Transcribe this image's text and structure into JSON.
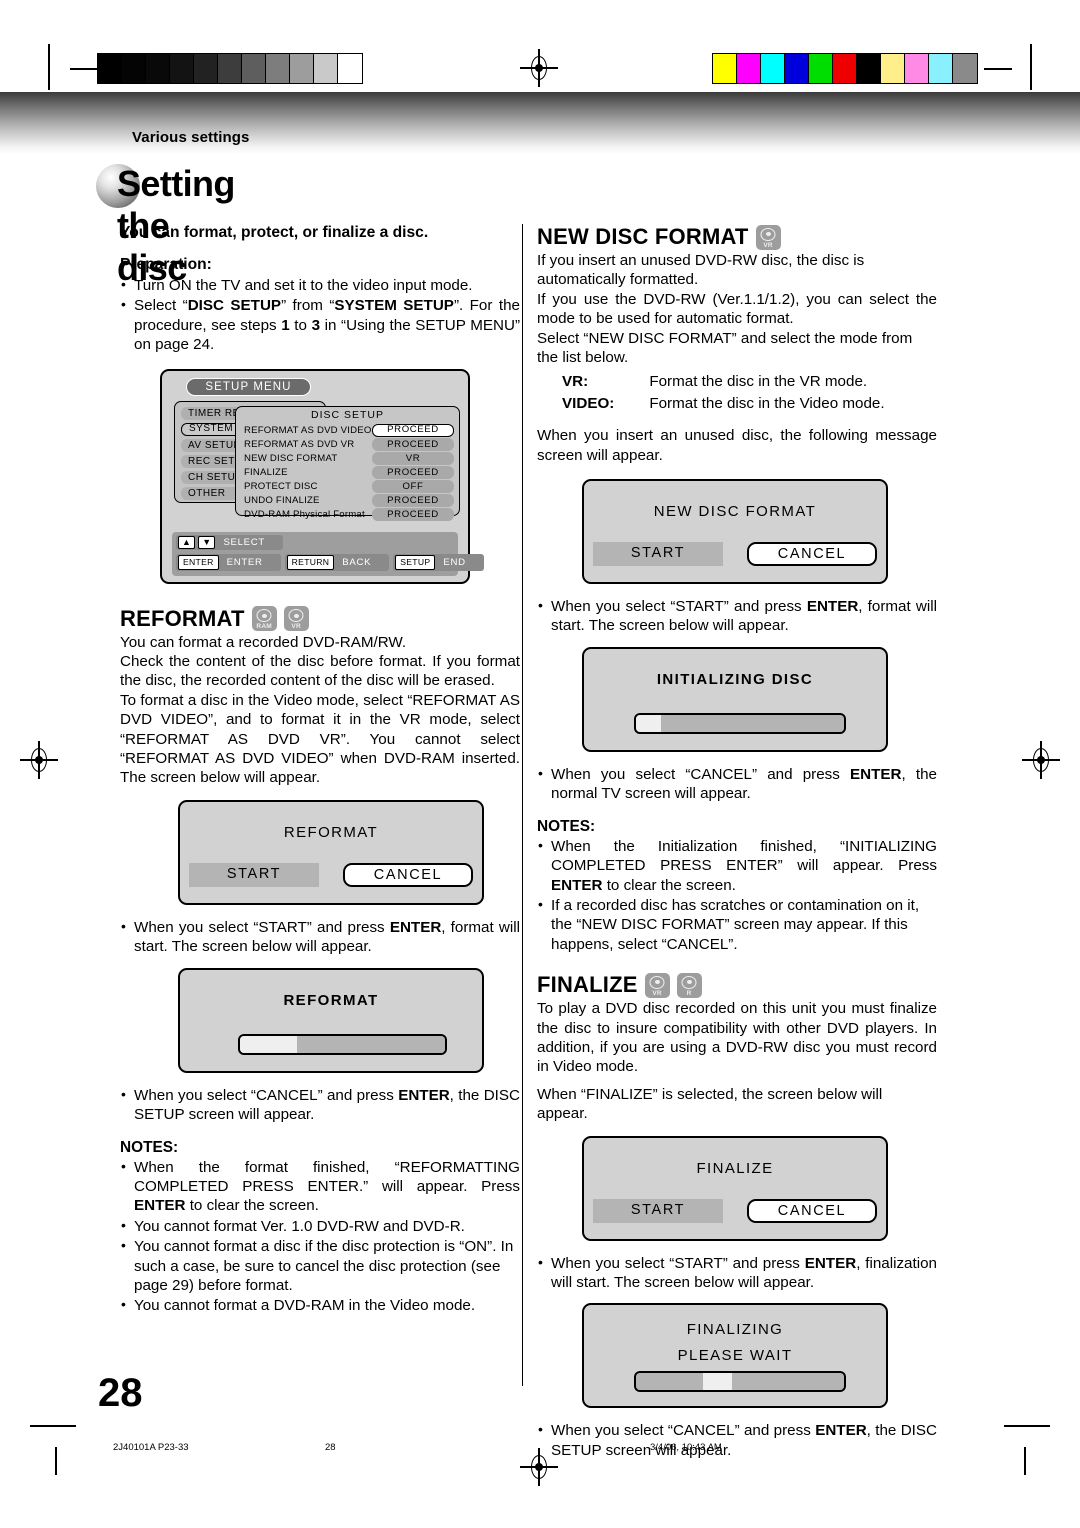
{
  "header": {
    "running_head": "Various settings",
    "page_title": "Setting the disc"
  },
  "intro": {
    "lead": "You can format, protect, or finalize a disc.",
    "prep_heading": "Preparation:",
    "bullets": [
      "Turn ON the TV and set it to the video input mode.",
      "Select “DISC SETUP” from “SYSTEM SETUP”. For the procedure, see steps 1 to 3 in “Using the SETUP MENU” on page 24."
    ]
  },
  "setup_menu_figure": {
    "title": "SETUP MENU",
    "left_items": [
      "TIMER REC SETUP",
      "SYSTEM SETUP",
      "AV SETUP",
      "REC SETUP",
      "CH SETUP",
      "OTHER"
    ],
    "selected_left_item": "SYSTEM SETUP",
    "submenu_title": "DISC SETUP",
    "rows": [
      {
        "label": "REFORMAT AS DVD VIDEO",
        "value": "PROCEED",
        "selected": true
      },
      {
        "label": "REFORMAT AS DVD VR",
        "value": "PROCEED",
        "selected": false
      },
      {
        "label": "NEW DISC FORMAT",
        "value": "VR",
        "selected": false
      },
      {
        "label": "FINALIZE",
        "value": "PROCEED",
        "selected": false
      },
      {
        "label": "PROTECT DISC",
        "value": "OFF",
        "selected": false
      },
      {
        "label": "UNDO FINALIZE",
        "value": "PROCEED",
        "selected": false
      },
      {
        "label": "DVD-RAM Physical Format",
        "value": "PROCEED",
        "selected": false
      }
    ],
    "footer_keys": [
      {
        "key": "▲ ▼",
        "action": "SELECT"
      },
      {
        "key": "ENTER",
        "action": "ENTER"
      },
      {
        "key": "RETURN",
        "action": "BACK"
      },
      {
        "key": "SETUP",
        "action": "END"
      }
    ]
  },
  "reformat": {
    "heading": "REFORMAT",
    "badges": [
      "RAM",
      "VR"
    ],
    "paragraphs": [
      "You can format a recorded DVD-RAM/RW.",
      "Check the content of the disc before format. If you format the disc, the recorded content of the disc will be erased.",
      "To format a disc in the Video mode, select “REFORMAT AS DVD VIDEO”, and to format it in the VR mode, select “REFORMAT AS DVD VR”. You cannot select “REFORMAT AS DVD VIDEO” when DVD-RAM inserted. The screen below will appear."
    ],
    "dialog": {
      "title": "REFORMAT",
      "start_label": "START",
      "cancel_label": "CANCEL"
    },
    "bullet_start": "When you select “START” and press ENTER, format will start. The screen below will appear.",
    "progress": {
      "title": "REFORMAT",
      "percent": 28
    },
    "bullet_cancel": "When you select “CANCEL” and press ENTER, the DISC SETUP screen will appear.",
    "notes_heading": "NOTES:",
    "notes": [
      "When the format finished, “REFORMATTING COMPLETED PRESS ENTER.” will appear. Press ENTER to clear the screen.",
      "You cannot format Ver. 1.0 DVD-RW and DVD-R.",
      "You cannot format a disc if the disc protection is “ON”. In such a case, be sure to cancel the disc protection (see page 29) before format.",
      "You cannot format a DVD-RAM in the Video mode."
    ]
  },
  "new_disc_format": {
    "heading": "NEW DISC FORMAT",
    "badges": [
      "VR"
    ],
    "paragraphs": [
      "If you insert an unused DVD-RW disc, the disc is automatically formatted.",
      "If you use the DVD-RW (Ver.1.1/1.2), you can select the mode to be used for automatic format.",
      "Select “NEW DISC FORMAT” and select the mode from the list below."
    ],
    "mode_list": [
      {
        "mode": "VR",
        "desc": "Format the disc in the VR mode."
      },
      {
        "mode": "VIDEO",
        "desc": "Format the disc in the Video mode."
      }
    ],
    "after_list": "When you insert an unused disc, the following message screen will appear.",
    "dialog": {
      "title": "NEW DISC FORMAT",
      "start_label": "START",
      "cancel_label": "CANCEL"
    },
    "bullet_start": "When you select “START” and press ENTER, format will start. The screen below will appear.",
    "progress": {
      "title": "INITIALIZING DISC",
      "percent": 12
    },
    "bullet_cancel": "When you select “CANCEL” and press ENTER, the normal TV screen will appear.",
    "notes_heading": "NOTES:",
    "notes": [
      "When the Initialization finished, “INITIALIZING COMPLETED PRESS ENTER” will appear. Press ENTER to clear the screen.",
      "If a recorded disc has scratches or contamination on it, the “NEW DISC FORMAT” screen may appear. If this happens, select “CANCEL”."
    ]
  },
  "finalize": {
    "heading": "FINALIZE",
    "badges": [
      "VR",
      "R"
    ],
    "paragraphs": [
      "To play a DVD disc recorded on this unit you must finalize the disc to insure compatibility with other DVD players. In addition, if you are using a DVD-RW disc you must record in Video mode.",
      "When “FINALIZE” is selected, the screen below will appear."
    ],
    "dialog": {
      "title": "FINALIZE",
      "start_label": "START",
      "cancel_label": "CANCEL"
    },
    "bullet_start": "When you select “START” and press ENTER, finalization will start. The screen below will appear.",
    "progress": {
      "title_line1": "FINALIZING",
      "title_line2": "PLEASE WAIT",
      "percent": 32
    },
    "bullet_cancel": "When you select “CANCEL” and press ENTER, the DISC SETUP screen will appear."
  },
  "page": {
    "number": "28"
  },
  "print_footer": {
    "job": "2J40101A P23-33",
    "page": "28",
    "timestamp": "3/4/06, 10:43 AM"
  },
  "calibration": {
    "grayscale": [
      "#000000",
      "#040404",
      "#090909",
      "#131313",
      "#222222",
      "#3d3d3d",
      "#5e5e5e",
      "#7d7d7d",
      "#9d9d9d",
      "#c9c9c9",
      "#ffffff"
    ],
    "colors": [
      "#ffff00",
      "#ff00ff",
      "#00ffff",
      "#0000dd",
      "#00dd00",
      "#ee0000",
      "#000000",
      "#ffef8a",
      "#ff8ae6",
      "#8af0ff",
      "#8a8a8a"
    ]
  }
}
